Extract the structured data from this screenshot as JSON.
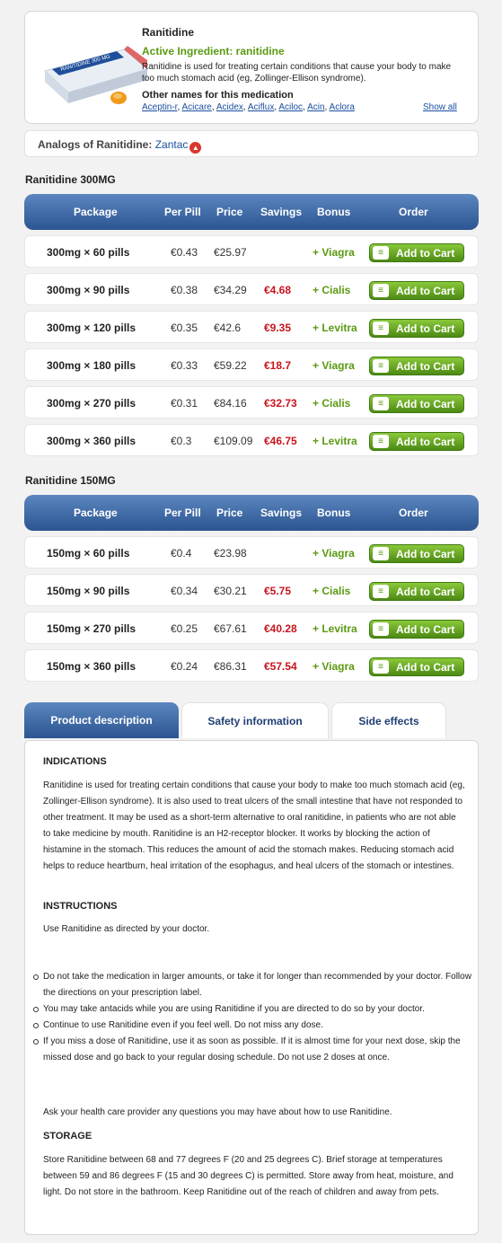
{
  "product": {
    "name": "Ranitidine",
    "active_ingredient": "Active Ingredient: ranitidine",
    "description": "Ranitidine is used for treating certain conditions that cause your body to make too much stomach acid (eg, Zollinger-Ellison syndrome).",
    "box_label": "RANITIDINE 300 MG",
    "other_names_title": "Other names for this medication",
    "other_names": [
      "Aceptin-r",
      "Acicare",
      "Acidex",
      "Aciflux",
      "Aciloc",
      "Acin",
      "Aclora"
    ],
    "show_all": "Show all"
  },
  "analogs": {
    "label": "Analogs of Ranitidine:",
    "link": "Zantac"
  },
  "columns": {
    "package": "Package",
    "per_pill": "Per Pill",
    "price": "Price",
    "savings": "Savings",
    "bonus": "Bonus",
    "order": "Order"
  },
  "cart_label": "Add to Cart",
  "sections": [
    {
      "title": "Ranitidine 300MG",
      "rows": [
        {
          "package": "300mg × 60 pills",
          "per_pill": "€0.43",
          "price": "€25.97",
          "savings": "",
          "bonus": "+ Viagra"
        },
        {
          "package": "300mg × 90 pills",
          "per_pill": "€0.38",
          "price": "€34.29",
          "savings": "€4.68",
          "bonus": "+ Cialis"
        },
        {
          "package": "300mg × 120 pills",
          "per_pill": "€0.35",
          "price": "€42.6",
          "savings": "€9.35",
          "bonus": "+ Levitra"
        },
        {
          "package": "300mg × 180 pills",
          "per_pill": "€0.33",
          "price": "€59.22",
          "savings": "€18.7",
          "bonus": "+ Viagra"
        },
        {
          "package": "300mg × 270 pills",
          "per_pill": "€0.31",
          "price": "€84.16",
          "savings": "€32.73",
          "bonus": "+ Cialis"
        },
        {
          "package": "300mg × 360 pills",
          "per_pill": "€0.3",
          "price": "€109.09",
          "savings": "€46.75",
          "bonus": "+ Levitra"
        }
      ]
    },
    {
      "title": "Ranitidine 150MG",
      "rows": [
        {
          "package": "150mg × 60 pills",
          "per_pill": "€0.4",
          "price": "€23.98",
          "savings": "",
          "bonus": "+ Viagra"
        },
        {
          "package": "150mg × 90 pills",
          "per_pill": "€0.34",
          "price": "€30.21",
          "savings": "€5.75",
          "bonus": "+ Cialis"
        },
        {
          "package": "150mg × 270 pills",
          "per_pill": "€0.25",
          "price": "€67.61",
          "savings": "€40.28",
          "bonus": "+ Levitra"
        },
        {
          "package": "150mg × 360 pills",
          "per_pill": "€0.24",
          "price": "€86.31",
          "savings": "€57.54",
          "bonus": "+ Viagra"
        }
      ]
    }
  ],
  "tabs": [
    "Product description",
    "Safety information",
    "Side effects"
  ],
  "content": {
    "indications_title": "INDICATIONS",
    "indications_text": "Ranitidine is used for treating certain conditions that cause your body to make too much stomach acid (eg, Zollinger-Ellison syndrome). It is also used to treat ulcers of the small intestine that have not responded to other treatment. It may be used as a short-term alternative to oral ranitidine, in patients who are not able to take medicine by mouth. Ranitidine is an H2-receptor blocker. It works by blocking the action of histamine in the stomach. This reduces the amount of acid the stomach makes. Reducing stomach acid helps to reduce heartburn, heal irritation of the esophagus, and heal ulcers of the stomach or intestines.",
    "instructions_title": "INSTRUCTIONS",
    "instructions_intro": "Use Ranitidine as directed by your doctor.",
    "bullets": [
      "Do not take the medication in larger amounts, or take it for longer than recommended by your doctor. Follow the directions on your prescription label.",
      "You may take antacids while you are using Ranitidine if you are directed to do so by your doctor.",
      "Continue to use Ranitidine even if you feel well. Do not miss any dose.",
      "If you miss a dose of Ranitidine, use it as soon as possible. If it is almost time for your next dose, skip the missed dose and go back to your regular dosing schedule. Do not use 2 doses at once."
    ],
    "ask_text": "Ask your health care provider any questions you may have about how to use Ranitidine.",
    "storage_title": "STORAGE",
    "storage_text": "Store Ranitidine between 68 and 77 degrees F (20 and 25 degrees C). Brief storage at temperatures between 59 and 86 degrees F (15 and 30 degrees C) is permitted. Store away from heat, moisture, and light. Do not store in the bathroom. Keep Ranitidine out of the reach of children and away from pets."
  },
  "colors": {
    "header_blue": "#2c5591",
    "green": "#5a9a12",
    "savings_red": "#c8141c",
    "link_blue": "#1a4fa0"
  }
}
